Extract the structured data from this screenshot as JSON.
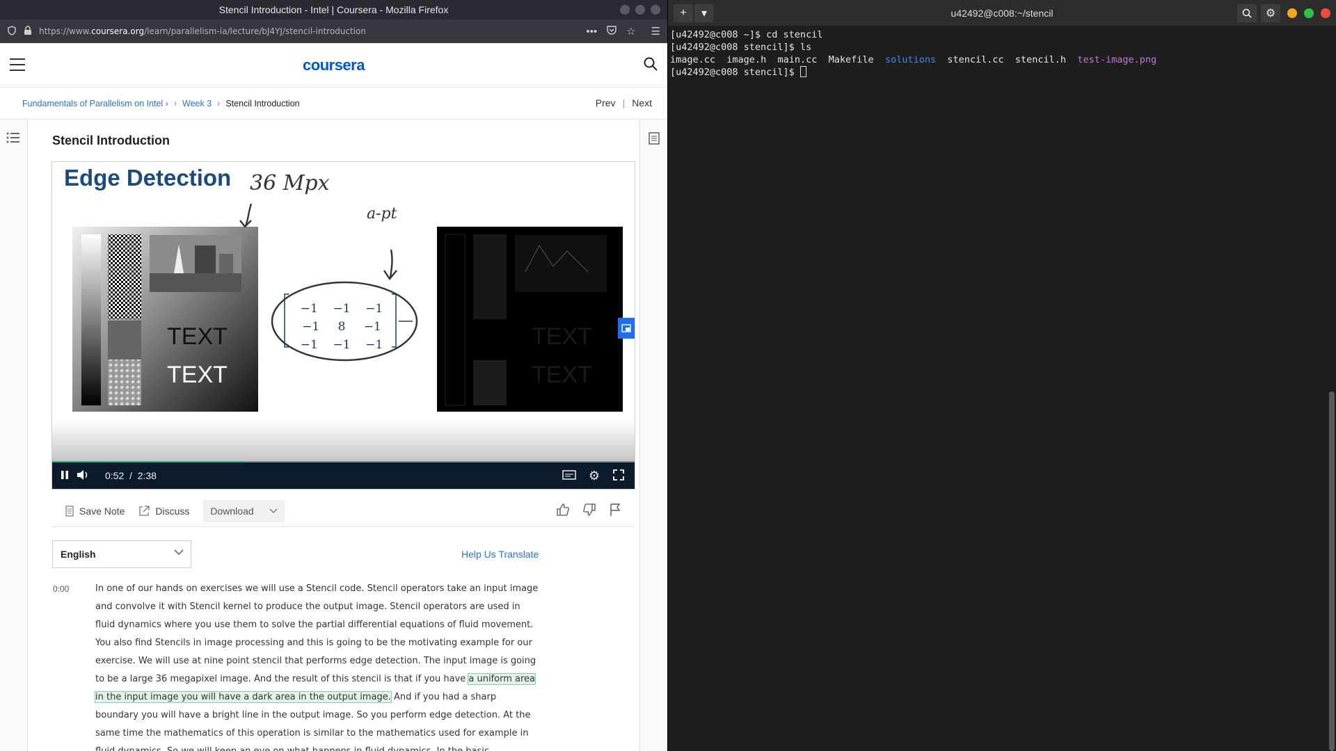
{
  "firefox": {
    "window_title": "Stencil Introduction - Intel | Coursera - Mozilla Firefox",
    "url_prefix": "https://www.",
    "url_domain": "coursera.org",
    "url_path": "/learn/parallelism-ia/lecture/bJ4YJ/stencil-introduction"
  },
  "coursera": {
    "logo": "coursera",
    "breadcrumb": [
      "Fundamentals of Parallelism on Intel ›",
      "Week 3",
      "Stencil Introduction"
    ],
    "prev": "Prev",
    "next": "Next",
    "lecture_title": "Stencil Introduction",
    "slide": {
      "title": "Edge Detection",
      "annot_size": "36 Mpx",
      "annot_op": "a-pt",
      "kernel": [
        [
          "−1",
          "−1",
          "−1"
        ],
        [
          "−1",
          "8",
          "−1"
        ],
        [
          "−1",
          "−1",
          "−1"
        ]
      ],
      "text_a": "TEXT",
      "text_b": "TEXT"
    },
    "video": {
      "current_time": "0:52",
      "total_time": "2:38",
      "progress": 0.33
    },
    "actions": {
      "save_note": "Save Note",
      "discuss": "Discuss",
      "download": "Download"
    },
    "language": "English",
    "help_translate": "Help Us Translate",
    "transcript": {
      "time": "0:00",
      "before": "In one of our hands on exercises we will use a Stencil code. Stencil operators take an input image and convolve it with Stencil kernel to produce the output image. Stencil operators are used in fluid dynamics where you use them to solve the partial differential equations of fluid movement. You also find Stencils in image processing and this is going to be the motivating example for our exercise. We will use at nine point stencil that performs edge detection. The input image is going to be a large 36 megapixel image. And the result of this stencil is that if you have ",
      "highlight": "a uniform area in the input image you will have a dark area in the output image.",
      "after": " And if you had a sharp boundary you will have a bright line in the output image. So you perform edge detection. At the same time the mathematics of this operation is similar to the mathematics used for example in fluid dynamics. So we will keep an eye on what happens in fluid dynamics. In the basic"
    }
  },
  "terminal": {
    "title": "u42492@c008:~/stencil",
    "line1": "[u42492@c008 ~]$ cd stencil",
    "line2": "[u42492@c008 stencil]$ ls",
    "files": [
      {
        "name": "image.cc",
        "type": "file"
      },
      {
        "name": "image.h",
        "type": "file"
      },
      {
        "name": "main.cc",
        "type": "file"
      },
      {
        "name": "Makefile",
        "type": "file"
      },
      {
        "name": "solutions",
        "type": "dir"
      },
      {
        "name": "stencil.cc",
        "type": "file"
      },
      {
        "name": "stencil.h",
        "type": "file"
      },
      {
        "name": "test-image.png",
        "type": "image"
      }
    ],
    "prompt": "[u42492@c008 stencil]$ "
  },
  "colors": {
    "coursera_blue": "#0056d2",
    "progress_green": "#2cb67d",
    "dir_blue": "#3a8ee6",
    "png_purple": "#c678dd"
  }
}
